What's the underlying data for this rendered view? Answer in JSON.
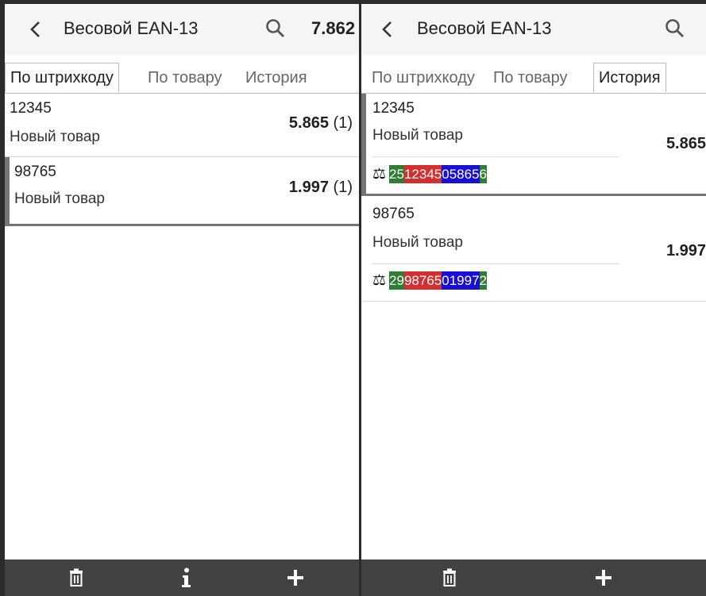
{
  "left": {
    "title": "Весовой EAN-13",
    "total": "7.862",
    "tabs": [
      {
        "label": "По штрихкоду",
        "active": true
      },
      {
        "label": "По товару",
        "active": false
      },
      {
        "label": "История",
        "active": false
      }
    ],
    "items": [
      {
        "code": "12345",
        "name": "Новый товар",
        "weight": "5.865",
        "count": "(1)"
      },
      {
        "code": "98765",
        "name": "Новый товар",
        "weight": "1.997",
        "count": "(1)"
      }
    ],
    "bottom_icons": [
      "trash-icon",
      "info-icon",
      "plus-icon"
    ]
  },
  "right": {
    "title": "Весовой EAN-13",
    "tabs": [
      {
        "label": "По штрихкоду",
        "active": false
      },
      {
        "label": "По товару",
        "active": false
      },
      {
        "label": "История",
        "active": true
      }
    ],
    "items": [
      {
        "code": "12345",
        "name": "Новый товар",
        "weight": "5.865",
        "barcode": {
          "prefix": "25",
          "item": "12345",
          "weight": "05865",
          "check": "6"
        }
      },
      {
        "code": "98765",
        "name": "Новый товар",
        "weight": "1.997",
        "barcode": {
          "prefix": "29",
          "item": "98765",
          "weight": "01997",
          "check": "2"
        }
      }
    ],
    "bottom_icons": [
      "trash-icon",
      "plus-icon"
    ]
  },
  "colors": {
    "prefix": "#2e7d32",
    "item": "#d32f2f",
    "weight": "#1a0fd6",
    "check": "#2e7d32",
    "selected_bar": "#757575",
    "bottom_bar": "#424242"
  }
}
